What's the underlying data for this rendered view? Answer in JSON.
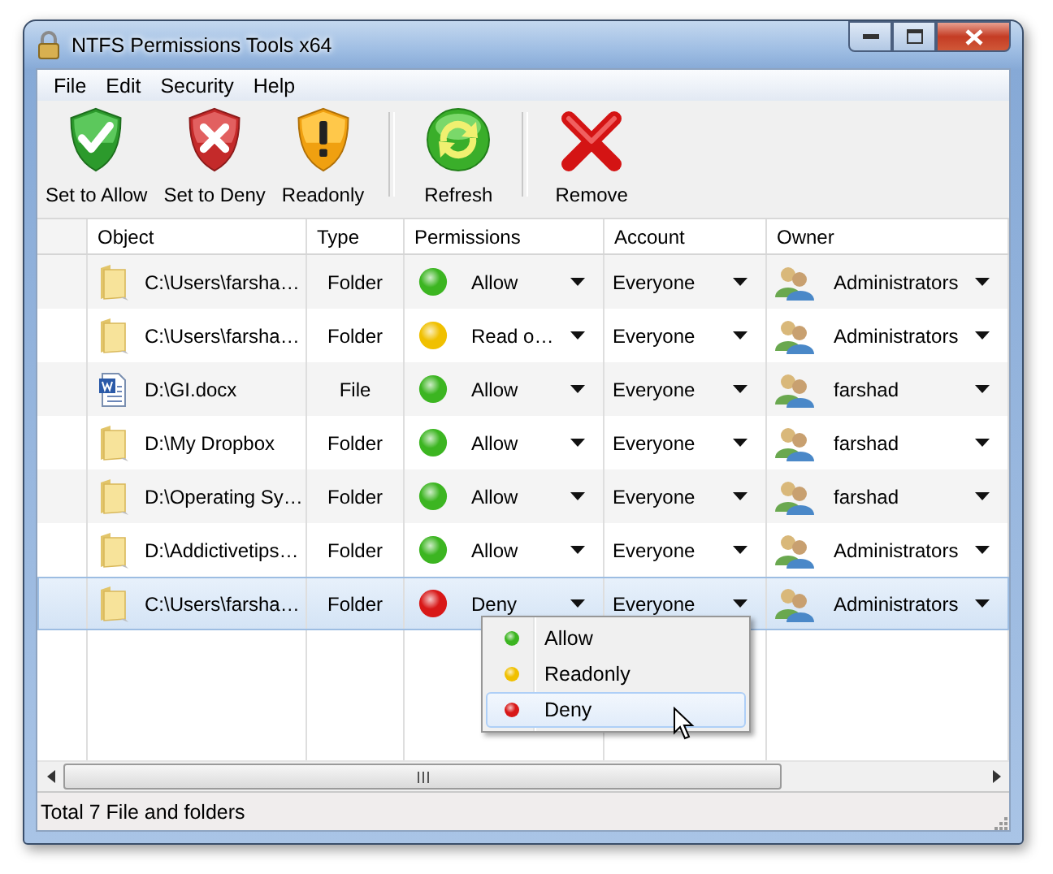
{
  "window": {
    "title": "NTFS Permissions Tools x64"
  },
  "menu": [
    "File",
    "Edit",
    "Security",
    "Help"
  ],
  "toolbar": [
    {
      "label": "Set to Allow",
      "kind": "allow",
      "separator_before": false
    },
    {
      "label": "Set to Deny",
      "kind": "deny",
      "separator_before": false
    },
    {
      "label": "Readonly",
      "kind": "readonly",
      "separator_before": false
    },
    {
      "label": "Refresh",
      "kind": "refresh",
      "separator_before": true
    },
    {
      "label": "Remove",
      "kind": "remove",
      "separator_before": true
    }
  ],
  "table": {
    "columns": [
      "Object",
      "Type",
      "Permissions",
      "Account",
      "Owner"
    ],
    "rows": [
      {
        "object": "C:\\Users\\farsha…",
        "kind": "folder",
        "type": "Folder",
        "permission": "Allow",
        "color": "#3cb521",
        "account": "Everyone",
        "owner": "Administrators",
        "selected": false
      },
      {
        "object": "C:\\Users\\farsha…",
        "kind": "folder",
        "type": "Folder",
        "permission": "Read o…",
        "color": "#f0c000",
        "account": "Everyone",
        "owner": "Administrators",
        "selected": false
      },
      {
        "object": "D:\\GI.docx",
        "kind": "document",
        "type": "File",
        "permission": "Allow",
        "color": "#3cb521",
        "account": "Everyone",
        "owner": "farshad",
        "selected": false
      },
      {
        "object": "D:\\My Dropbox",
        "kind": "folder",
        "type": "Folder",
        "permission": "Allow",
        "color": "#3cb521",
        "account": "Everyone",
        "owner": "farshad",
        "selected": false
      },
      {
        "object": "D:\\Operating Sy…",
        "kind": "folder",
        "type": "Folder",
        "permission": "Allow",
        "color": "#3cb521",
        "account": "Everyone",
        "owner": "farshad",
        "selected": false
      },
      {
        "object": "D:\\Addictivetips…",
        "kind": "folder",
        "type": "Folder",
        "permission": "Allow",
        "color": "#3cb521",
        "account": "Everyone",
        "owner": "Administrators",
        "selected": false
      },
      {
        "object": "C:\\Users\\farsha…",
        "kind": "folder",
        "type": "Folder",
        "permission": "Deny",
        "color": "#d81818",
        "account": "Everyone",
        "owner": "Administrators",
        "selected": true
      }
    ]
  },
  "dropdown_menu": {
    "items": [
      {
        "label": "Allow",
        "color": "#3cb521",
        "selected": false
      },
      {
        "label": "Readonly",
        "color": "#f0c000",
        "selected": false
      },
      {
        "label": "Deny",
        "color": "#d81818",
        "selected": true
      }
    ]
  },
  "status_bar": "Total 7 File and folders"
}
